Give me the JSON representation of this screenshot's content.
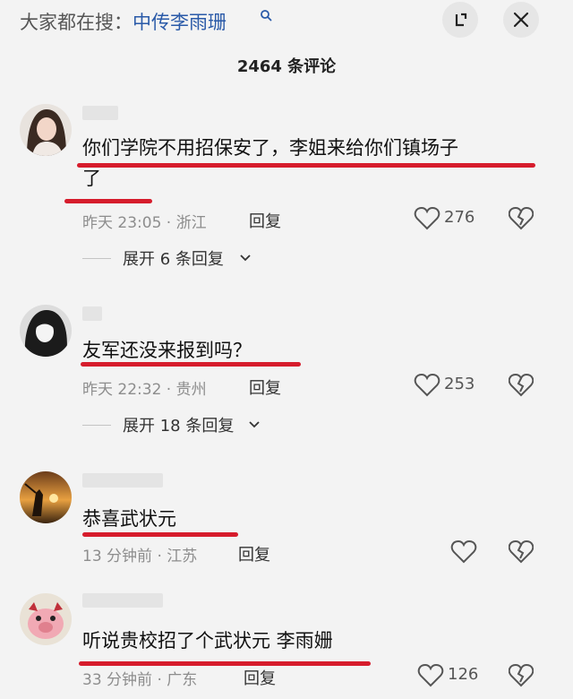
{
  "header": {
    "search_prefix": "大家都在搜：",
    "search_query": "中传李雨珊",
    "comment_count": "2464 条评论",
    "accent": "#2a5aa8"
  },
  "comments": [
    {
      "text_line1": "你们学院不用招保安了，李姐来给你们镇场子",
      "text_line2": "了",
      "meta": "昨天 23:05 · 浙江",
      "reply_label": "回复",
      "likes": "276",
      "expand_label": "展开 6 条回复"
    },
    {
      "text_line1": "友军还没来报到吗？",
      "meta": "昨天 22:32 · 贵州",
      "reply_label": "回复",
      "likes": "253",
      "expand_label": "展开 18 条回复"
    },
    {
      "text_line1": "恭喜武状元",
      "meta": "13 分钟前 · 江苏",
      "reply_label": "回复",
      "likes": ""
    },
    {
      "text_line1": "听说贵校招了个武状元 李雨姗",
      "meta": "33 分钟前 · 广东",
      "reply_label": "回复",
      "likes": "126"
    }
  ],
  "icons": {
    "search": "search-icon",
    "expand": "expand-icon",
    "close": "close-icon",
    "like": "heart-icon",
    "dislike": "broken-heart-icon",
    "chevron": "chevron-down-icon"
  },
  "colors": {
    "highlight_underline": "#d61c2c",
    "meta_text": "#8d8d8d",
    "background": "#f3f3f3"
  }
}
